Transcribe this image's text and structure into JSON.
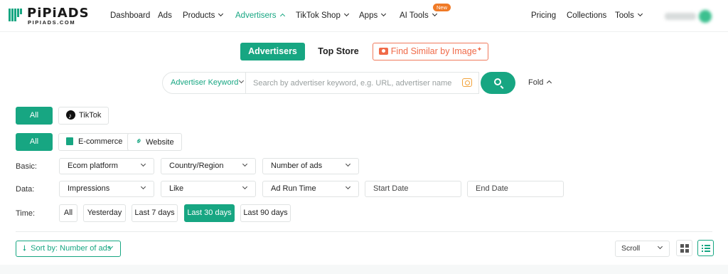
{
  "brand": {
    "name": "PiPiADS",
    "domain": "PIPIADS.COM"
  },
  "nav": {
    "items": [
      {
        "label": "Dashboard"
      },
      {
        "label": "Ads"
      },
      {
        "label": "Products"
      },
      {
        "label": "Advertisers"
      },
      {
        "label": "TikTok Shop"
      },
      {
        "label": "Apps"
      },
      {
        "label": "AI Tools"
      }
    ],
    "new_badge": "New",
    "right": [
      {
        "label": "Pricing"
      },
      {
        "label": "Collections"
      },
      {
        "label": "Tools"
      }
    ],
    "active": "Advertisers"
  },
  "mode_tabs": {
    "advertisers": "Advertisers",
    "top_store": "Top Store",
    "find_similar": "Find Similar by Image"
  },
  "search": {
    "type_label": "Advertiser Keyword",
    "placeholder": "Search by advertiser keyword, e.g. URL, advertiser name",
    "fold_label": "Fold"
  },
  "platform_filter": {
    "all": "All",
    "tiktok": "TikTok"
  },
  "site_filter": {
    "all": "All",
    "ecommerce": "E-commerce",
    "website": "Website"
  },
  "basic": {
    "label": "Basic:",
    "selects": [
      "Ecom platform",
      "Country/Region",
      "Number of ads"
    ]
  },
  "data_row": {
    "label": "Data:",
    "selects": [
      "Impressions",
      "Like",
      "Ad Run Time"
    ],
    "start_date": "Start Date",
    "end_date": "End Date"
  },
  "time": {
    "label": "Time:",
    "options": [
      "All",
      "Yesterday",
      "Last 7 days",
      "Last 30 days",
      "Last 90 days"
    ],
    "selected": "Last 30 days"
  },
  "toolbar": {
    "sort_label": "Sort by: Number of ads",
    "scroll_label": "Scroll",
    "view_mode": "list"
  },
  "colors": {
    "accent": "#17a682",
    "orange": "#f06a48",
    "badge": "#f07a26"
  },
  "icons": [
    "logo-mark",
    "caret-down-icon",
    "camera-icon",
    "sparkle-icon",
    "image-search-icon",
    "search-icon",
    "tiktok-icon",
    "ecommerce-icon",
    "link-icon",
    "sort-icon",
    "grid-view-icon",
    "list-view-icon"
  ]
}
